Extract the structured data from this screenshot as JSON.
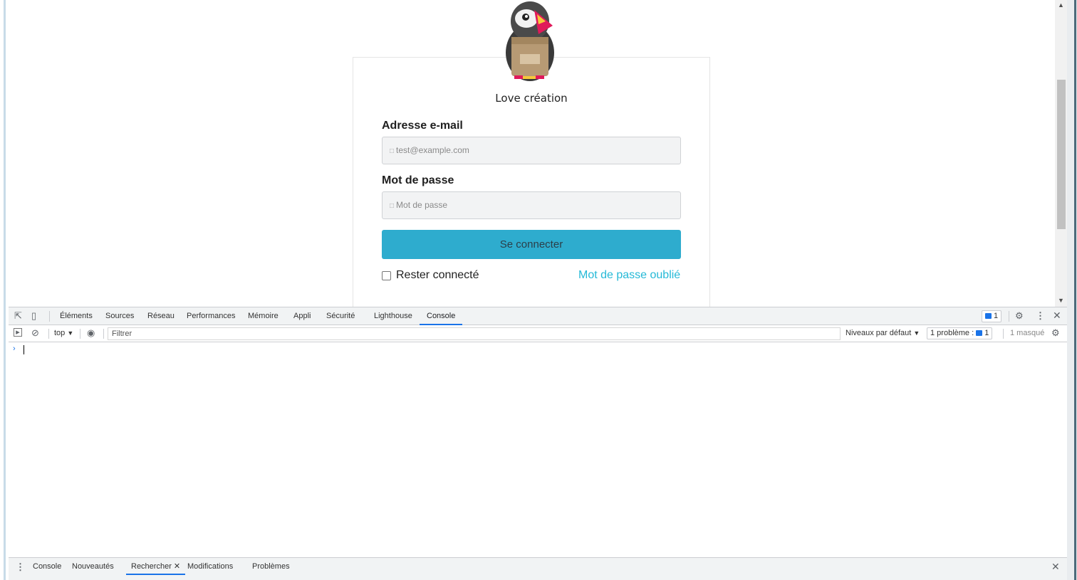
{
  "page": {
    "shop_name": "Love création",
    "email_label": "Adresse e-mail",
    "email_placeholder": "test@example.com",
    "password_label": "Mot de passe",
    "password_placeholder": "Mot de passe",
    "submit_label": "Se connecter",
    "remember_label": "Rester connecté",
    "remember_checked": false,
    "forgot_label": "Mot de passe oublié",
    "accent_color": "#25b9d7",
    "button_color": "#2eacce"
  },
  "devtools": {
    "tabs": [
      "Éléments",
      "Sources",
      "Réseau",
      "Performances",
      "Mémoire",
      "Appli",
      "Sécurité",
      "Lighthouse",
      "Console"
    ],
    "active_tab": "Console",
    "issues_badge_count": "1",
    "console": {
      "context": "top",
      "filter_placeholder": "Filtrer",
      "levels": "Niveaux par défaut",
      "problems_label": "1 problème :",
      "problems_count": "1",
      "hidden": "1 masqué"
    },
    "drawer_tabs": [
      "Console",
      "Nouveautés",
      "Rechercher",
      "Modifications",
      "Problèmes"
    ],
    "drawer_active": "Rechercher"
  }
}
